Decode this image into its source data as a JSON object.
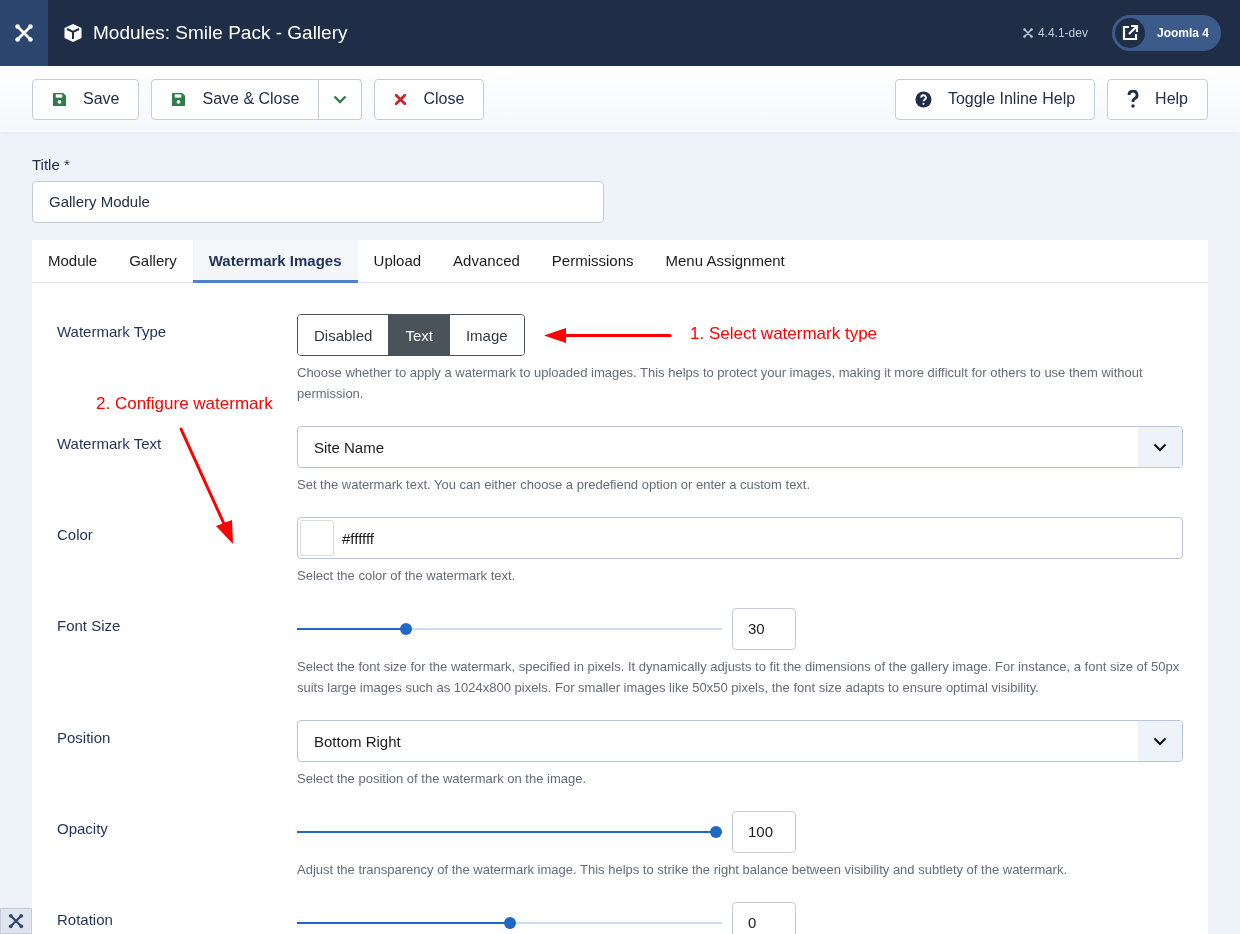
{
  "header": {
    "title": "Modules: Smile Pack - Gallery",
    "version": "4.4.1-dev",
    "site_button": "Joomla 4"
  },
  "toolbar": {
    "left": [
      {
        "label": "Save",
        "dropdown": false
      },
      {
        "label": "Save & Close",
        "dropdown": true
      },
      {
        "label": "Close",
        "dropdown": false
      }
    ],
    "right": [
      {
        "label": "Toggle Inline Help",
        "dropdown": false
      },
      {
        "label": "Help",
        "dropdown": false
      }
    ]
  },
  "title_field": {
    "label": "Title *",
    "value": "Gallery Module"
  },
  "tabs": [
    {
      "label": "Module",
      "selected": false
    },
    {
      "label": "Gallery",
      "selected": false
    },
    {
      "label": "Watermark Images",
      "selected": true
    },
    {
      "label": "Upload",
      "selected": false
    },
    {
      "label": "Advanced",
      "selected": false
    },
    {
      "label": "Permissions",
      "selected": false
    },
    {
      "label": "Menu Assignment",
      "selected": false
    }
  ],
  "fields": [
    {
      "kind": "segmented",
      "label": "Watermark Type",
      "options": [
        {
          "label": "Disabled",
          "selected": false
        },
        {
          "label": "Text",
          "selected": true
        },
        {
          "label": "Image",
          "selected": false
        }
      ],
      "description": "Choose whether to apply a watermark to uploaded images. This helps to protect your images, making it more difficult for others to use them without permission."
    },
    {
      "kind": "select",
      "label": "Watermark Text",
      "value": "Site Name",
      "description": "Set the watermark text. You can either choose a predefiend option or enter a custom text."
    },
    {
      "kind": "color",
      "label": "Color",
      "value": "#ffffff",
      "description": "Select the color of the watermark text."
    },
    {
      "kind": "slider",
      "label": "Font Size",
      "level": 0.25,
      "value": "30",
      "description": "Select the font size for the watermark, specified in pixels. It dynamically adjusts to fit the dimensions of the gallery image. For instance, a font size of 50px suits large images such as 1024x800 pixels. For smaller images like 50x50 pixels, the font size adapts to ensure optimal visibility."
    },
    {
      "kind": "select",
      "label": "Position",
      "value": "Bottom Right",
      "description": "Select the position of the watermark on the image."
    },
    {
      "kind": "slider",
      "label": "Opacity",
      "level": 1,
      "value": "100",
      "description": "Adjust the transparency of the watermark image. This helps to strike the right balance between visibility and subtlety of the watermark."
    },
    {
      "kind": "slider",
      "label": "Rotation",
      "level": 0.5,
      "value": "0"
    }
  ],
  "annotations": [
    {
      "text": "1. Select watermark type",
      "kind": "left"
    },
    {
      "text": "2. Configure watermark",
      "kind": "down"
    }
  ]
}
